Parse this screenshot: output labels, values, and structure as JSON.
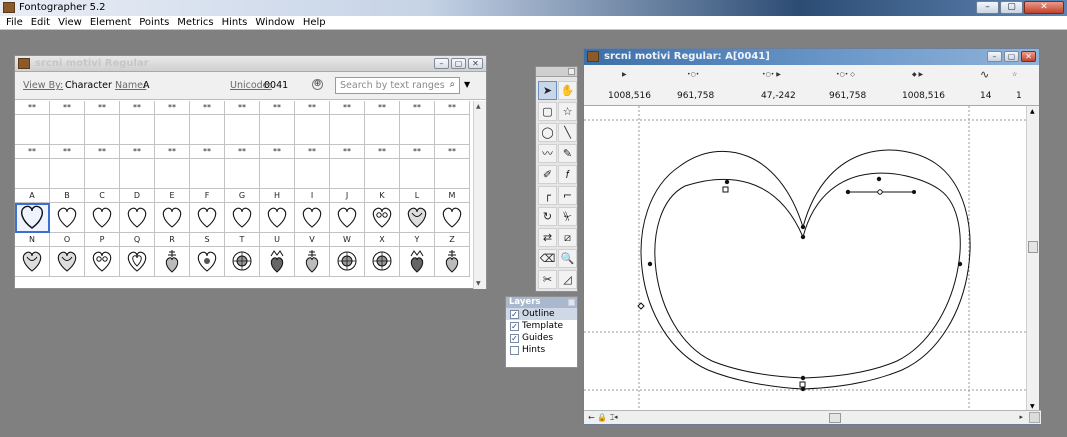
{
  "app": {
    "title": "Fontographer 5.2"
  },
  "window_controls": [
    "–",
    "▢",
    "✕"
  ],
  "menu": [
    "File",
    "Edit",
    "View",
    "Element",
    "Points",
    "Metrics",
    "Hints",
    "Window",
    "Help"
  ],
  "font_window": {
    "title": "srcni motivi Regular",
    "view_by_label": "View By:",
    "view_by_value": "Character",
    "name_label": "Name:",
    "name_value": "A",
    "unicode_label": "Unicode:",
    "unicode_value": "0041",
    "add_symbol": "⊕",
    "search_placeholder": "Search by text ranges",
    "search_icon": "⌕",
    "dropdown_arrow": "▼",
    "empty_label": "**",
    "letters_row1": [
      "A",
      "B",
      "C",
      "D",
      "E",
      "F",
      "G",
      "H",
      "I",
      "J",
      "K",
      "L",
      "M"
    ],
    "letters_row2": [
      "N",
      "O",
      "P",
      "Q",
      "R",
      "S",
      "T",
      "U",
      "V",
      "W",
      "X",
      "Y",
      "Z"
    ],
    "selected_glyph": "A",
    "glyph_icons": [
      "heart-outline-icon",
      "heart-ornament-icon",
      "heart-swirl-icon",
      "heart-flourish-icon",
      "heart-floral-icon",
      "heart-crown-icon",
      "heart-filigree-icon",
      "heart-rosette-icon"
    ]
  },
  "tool_palette": {
    "tools": [
      "pointer-tool",
      "hand-tool",
      "rectangle-tool",
      "star-tool",
      "ellipse-tool",
      "line-tool",
      "freehand-tool",
      "pen-tool",
      "curve-point-tool",
      "calligraphy-tool",
      "corner-point-tool",
      "tangent-point-tool",
      "rotate-tool",
      "scale-tool",
      "flip-tool",
      "skew-tool",
      "eraser-tool",
      "zoom-tool",
      "knife-tool",
      "measure-tool"
    ]
  },
  "layers_panel": {
    "title": "Layers",
    "items": [
      {
        "label": "Outline",
        "checked": true
      },
      {
        "label": "Template",
        "checked": true
      },
      {
        "label": "Guides",
        "checked": true
      },
      {
        "label": "Hints",
        "checked": false
      }
    ]
  },
  "glyph_window": {
    "title": "srcni motivi Regular: A[0041]",
    "coords": [
      {
        "icon": "cursor-position-icon",
        "value": "1008,516"
      },
      {
        "icon": "origin-point-icon",
        "value": "961,758"
      },
      {
        "icon": "offset-icon",
        "value": "47,-242"
      },
      {
        "icon": "point-distance-icon",
        "value": "961,758"
      },
      {
        "icon": "angle-icon",
        "value": "1008,516"
      },
      {
        "icon": "curve-count-icon",
        "value": "14"
      },
      {
        "icon": "selection-count-icon",
        "value": "1"
      }
    ],
    "status_left": "← 🔒 ⌶",
    "scroll_left": "◂",
    "scroll_right": "▸"
  }
}
